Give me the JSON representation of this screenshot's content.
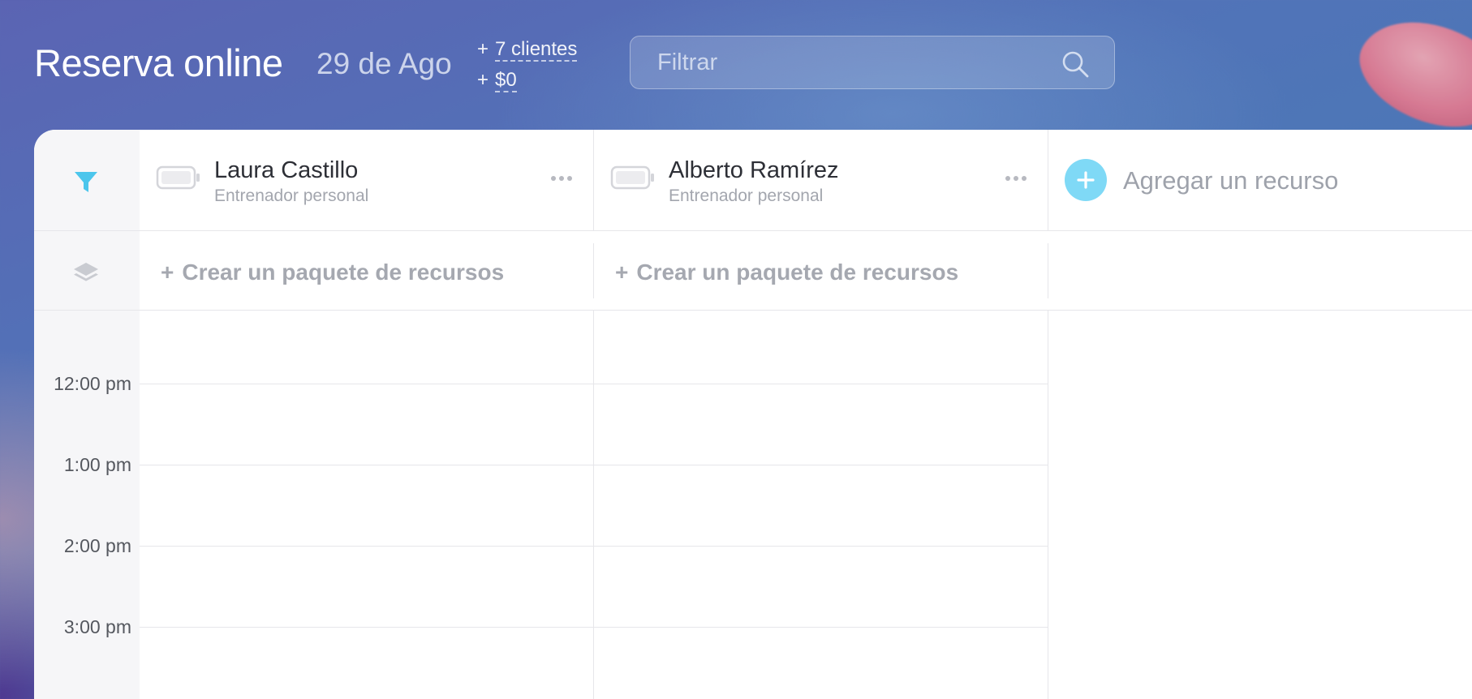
{
  "header": {
    "title": "Reserva online",
    "date": "29 de Ago",
    "stats": [
      {
        "prefix": "+",
        "value": "7 clientes"
      },
      {
        "prefix": "+",
        "value": "$0"
      }
    ],
    "search": {
      "placeholder": "Filtrar",
      "value": ""
    }
  },
  "resources": [
    {
      "name": "Laura Castillo",
      "role": "Entrenador personal"
    },
    {
      "name": "Alberto Ramírez",
      "role": "Entrenador personal"
    }
  ],
  "add_resource_label": "Agregar un recurso",
  "package_row": {
    "create_label": "Crear un paquete de recursos",
    "plus": "+"
  },
  "times": [
    "12:00 pm",
    "1:00 pm",
    "2:00 pm",
    "3:00 pm"
  ],
  "colors": {
    "accent": "#7fd9f6",
    "filter_icon": "#4cc6ec",
    "muted_text": "#a5a8b0",
    "grid_line": "#e6e6ea"
  },
  "icons": {
    "filter": "filter-icon",
    "layers": "layers-icon",
    "battery": "battery-icon",
    "more": "more-dots-icon",
    "search": "search-icon",
    "add": "plus-icon"
  }
}
